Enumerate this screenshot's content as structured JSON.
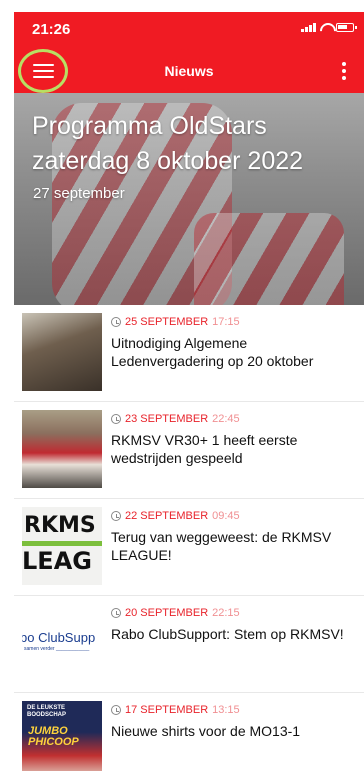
{
  "status": {
    "time": "21:26"
  },
  "nav": {
    "title": "Nieuws",
    "menu_icon": "hamburger-menu-icon",
    "more_icon": "more-vertical-icon"
  },
  "hero": {
    "title": "Programma OldStars zaterdag 8 oktober 2022",
    "date": "27 september"
  },
  "news": [
    {
      "date": "25 SEPTEMBER",
      "time": "17:15",
      "headline": "Uitnodiging Algemene Ledenvergadering op 20 oktober"
    },
    {
      "date": "23 SEPTEMBER",
      "time": "22:45",
      "headline": "RKMSV VR30+ 1 heeft eerste wedstrijden gespeeld"
    },
    {
      "date": "22 SEPTEMBER",
      "time": "09:45",
      "headline": "Terug van weggeweest: de RKMSV LEAGUE!"
    },
    {
      "date": "20 SEPTEMBER",
      "time": "22:15",
      "headline": "Rabo ClubSupport: Stem op RKMSV!"
    },
    {
      "date": "17 SEPTEMBER",
      "time": "13:15",
      "headline": "Nieuwe shirts voor de MO13-1"
    }
  ],
  "colors": {
    "brand_red": "#f01b23",
    "accent_date": "#e8232b",
    "highlight_ring": "#b8df63"
  }
}
